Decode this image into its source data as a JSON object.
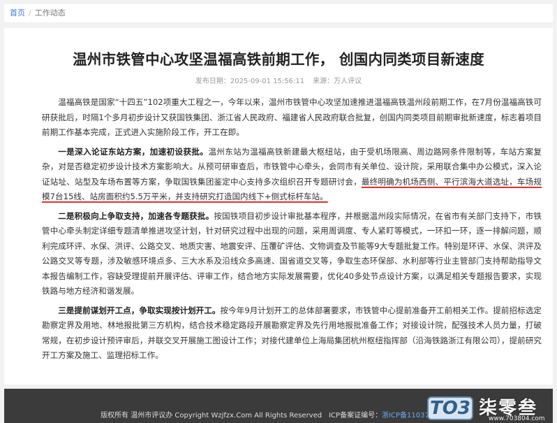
{
  "breadcrumb": {
    "home": "首页",
    "separator": "/",
    "current": "工作动态"
  },
  "article": {
    "title": "温州市铁管中心攻坚温福高铁前期工作， 创国内同类项目新速度",
    "publish_date_label": "发布日期：",
    "publish_date": "2025-09-01 15:56:11",
    "source_label": "来源：",
    "source": "万人评议",
    "p1": "温福高铁是国家“十四五”102项重大工程之一，今年以来，温州市铁管中心攻坚加速推进温福高铁温州段前期工作，在7月份温福高铁可研获批后，时隔1个多月初步设计又获国铁集团、浙江省人民政府、福建省人民政府联合批复，创国内同类项目前期审批新速度，标志着项目前期工作基本完成，正式进入实施阶段工作，开工在即。",
    "p2_lead": "一是深入论证东站方案，加速初设获批。",
    "p2_text": "温州东站为温福高铁新建最大枢纽站，由于受机场限高、周边路网条件限制等，车站方案复杂，对是否稳定初步设计技术方案影响大。从预可研审查后，市铁管中心牵头，会同市有关单位、设计院，采用联合集中办公模式，深入论证站址、站型及车场布置等方案，争取国铁集团鉴定中心支持多次组织召开专题研讨会，",
    "p2_highlight": "最终明确为机场西侧、平行滨海大道选址，车场规模7台15线、站房面积约5.5万平米，并支持研究打造国内线下+侧式标杆车站。",
    "p3_lead": "二是积极向上争取支持，加速各专题获批。",
    "p3_text": "按国铁项目初步设计审批基本程序，并根据温州段实际情况，在省市有关部门支持下，市铁管中心牵头制定详细专题清单推进攻坚计划，针对研究过程中出现的问题，采用周调度、专人紧盯等模式，一环扣一环，逐一排解问题，顺利完成环评、水保、洪评、公路交叉、地质灾害、地震安评、压覆矿评估、文物调查及节能等9大专题批复工作。特别是环评、水保、洪评及公路交叉等专题，涉及敏感环境点多、三大水系及沿线众多高速、国省道交叉等，争取生态环保部、水利部等行业主管部门支持帮助指导文本报告编制工作，容缺受理提前开展评估、评审工作，结合地方实际发展需要，优化40多处节点设计方案，以满足相关专题报告要求，实现铁路与地方经济和谐发展。",
    "p4_lead": "三是提前谋划开工点，争取实现按计划开工。",
    "p4_text": "按今年9月计划开工的总体部署要求，市铁管中心提前准备开工前相关工作。提前招标选定勘察定界及用地、林地报批第三方机构，结合技术稳定路段开展勘察定界及先行用地报批准备工作；对接设计院，配强技术人员力量，打破常规，在初步设计预评审后，并联交叉开展施工图设计工作；对接代建单位上海局集团杭州枢纽指挥部（沿海铁路浙江有限公司），提前研究开工方案及施工、监理招标工作。"
  },
  "footer": {
    "copyright": "版权所有 温州市评议办 Copyright Wzjfzx.Com All Rights Reserved",
    "icp_label": "ICP备案证编号：",
    "icp_value": "浙ICP备11037209号-1"
  },
  "watermark": {
    "logo": "TO3",
    "name": "柒零叁",
    "url": "www.703804.com"
  }
}
